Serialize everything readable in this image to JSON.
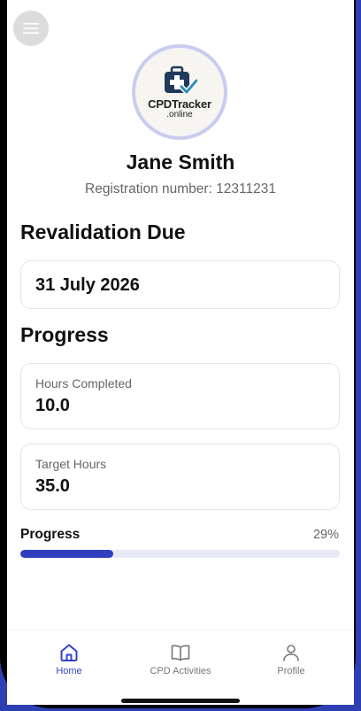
{
  "profile": {
    "logo_name": "CPDTracker",
    "logo_suffix": ".online",
    "name": "Jane Smith",
    "registration": "Registration number: 12311231"
  },
  "revalidation": {
    "title": "Revalidation Due",
    "date": "31 July 2026"
  },
  "progress_section": {
    "title": "Progress",
    "hours_completed_label": "Hours Completed",
    "hours_completed_value": "10.0",
    "target_hours_label": "Target Hours",
    "target_hours_value": "35.0",
    "bar_label": "Progress",
    "percent_text": "29%",
    "percent_value": 0.29
  },
  "tabbar": {
    "items": [
      {
        "label": "Home",
        "icon": "home-icon",
        "active": true
      },
      {
        "label": "CPD Activities",
        "icon": "book-icon",
        "active": false
      },
      {
        "label": "Profile",
        "icon": "person-icon",
        "active": false
      }
    ]
  },
  "colors": {
    "accent": "#2f3fbf",
    "frame_edge": "#2e3fb4",
    "logo_ring": "#c8cdf0",
    "track": "#e8e9f6"
  }
}
